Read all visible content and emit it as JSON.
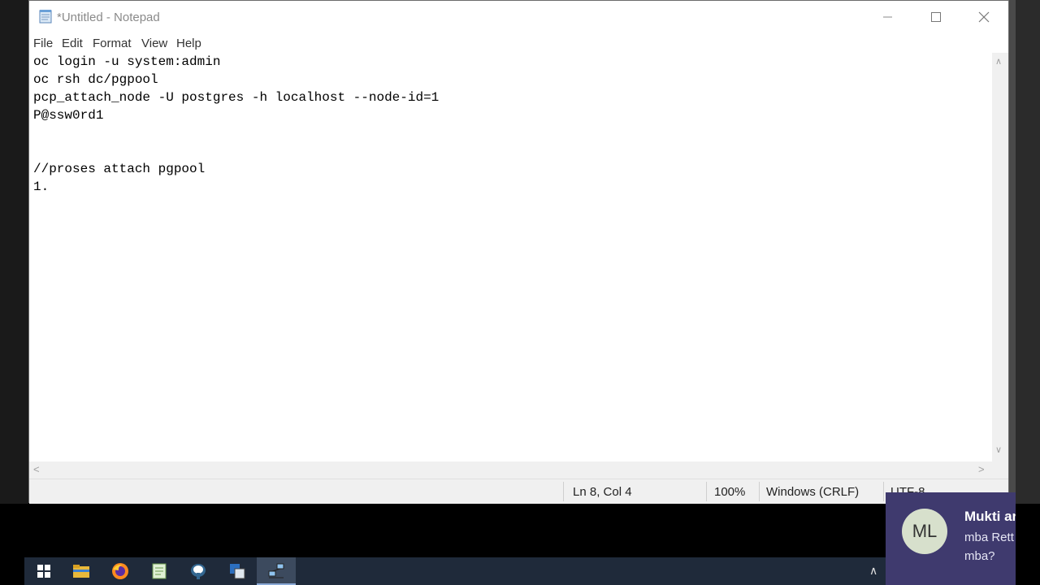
{
  "window": {
    "title": "*Untitled - Notepad"
  },
  "menu": [
    {
      "acc": "F",
      "rest": "ile"
    },
    {
      "acc": "E",
      "rest": "dit"
    },
    {
      "acc": "F",
      "rest": "ormat",
      "acc_after": "o"
    },
    {
      "acc": "V",
      "rest": "iew"
    },
    {
      "acc": "H",
      "rest": "elp"
    }
  ],
  "menu_labels": {
    "file": "File",
    "edit": "Edit",
    "format": "Format",
    "view": "View",
    "help": "Help"
  },
  "editor": {
    "lines": [
      "oc login -u system:admin",
      "oc rsh dc/pgpool",
      "pcp_attach_node -U postgres -h localhost --node-id=1",
      "P@ssw0rd1",
      "",
      "",
      "//proses attach pgpool",
      "1."
    ]
  },
  "status": {
    "position": "Ln 8, Col 4",
    "zoom": "100%",
    "line_ending": "Windows (CRLF)",
    "encoding": "UTF-8"
  },
  "notification": {
    "initials": "ML",
    "name": "Mukti ar",
    "message": "mba Rett mba?"
  },
  "taskbar": {
    "items": [
      "start-icon",
      "file-explorer-icon",
      "firefox-icon",
      "notepad-plus-icon",
      "pgadmin-icon",
      "remote-app-icon",
      "network-app-icon"
    ]
  }
}
